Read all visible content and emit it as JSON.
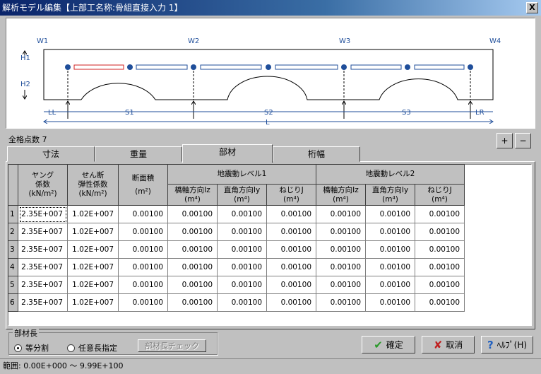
{
  "window": {
    "title": "解析モデル編集【上部工名称:骨組直接入力 1】",
    "close": "X"
  },
  "diagram": {
    "supports": [
      "W1",
      "W2",
      "W3",
      "W4"
    ],
    "heights": [
      "H1",
      "H2"
    ],
    "spans": [
      "LL",
      "S1",
      "S2",
      "S3",
      "LR"
    ],
    "total": "L",
    "selected_member": 1,
    "colors": {
      "node": "#1f4e9a",
      "member": "#1f4e9a",
      "selected": "#d02020"
    }
  },
  "summary": {
    "node_count_label": "全格点数 7"
  },
  "zoom": {
    "in": "+",
    "out": "−"
  },
  "tabs": [
    {
      "label": "寸法"
    },
    {
      "label": "重量"
    },
    {
      "label": "部材",
      "selected": true
    },
    {
      "label": "桁幅"
    }
  ],
  "table": {
    "headers": {
      "young": [
        "ヤング",
        "係数",
        "(kN/m²)"
      ],
      "shear": [
        "せん断",
        "弾性係数",
        "(kN/m²)"
      ],
      "area": [
        "断面積",
        "(m²)"
      ],
      "level1": "地震動レベル1",
      "level2": "地震動レベル2",
      "sub": [
        [
          "橋軸方向Iz",
          "(m⁴)"
        ],
        [
          "直角方向Iy",
          "(m⁴)"
        ],
        [
          "ねじりJ",
          "(m⁴)"
        ],
        [
          "橋軸方向Iz",
          "(m⁴)"
        ],
        [
          "直角方向Iy",
          "(m⁴)"
        ],
        [
          "ねじりJ",
          "(m⁴)"
        ]
      ]
    },
    "rows": [
      [
        "1",
        "2.35E+007",
        "1.02E+007",
        "0.00100",
        "0.00100",
        "0.00100",
        "0.00100",
        "0.00100",
        "0.00100",
        "0.00100"
      ],
      [
        "2",
        "2.35E+007",
        "1.02E+007",
        "0.00100",
        "0.00100",
        "0.00100",
        "0.00100",
        "0.00100",
        "0.00100",
        "0.00100"
      ],
      [
        "3",
        "2.35E+007",
        "1.02E+007",
        "0.00100",
        "0.00100",
        "0.00100",
        "0.00100",
        "0.00100",
        "0.00100",
        "0.00100"
      ],
      [
        "4",
        "2.35E+007",
        "1.02E+007",
        "0.00100",
        "0.00100",
        "0.00100",
        "0.00100",
        "0.00100",
        "0.00100",
        "0.00100"
      ],
      [
        "5",
        "2.35E+007",
        "1.02E+007",
        "0.00100",
        "0.00100",
        "0.00100",
        "0.00100",
        "0.00100",
        "0.00100",
        "0.00100"
      ],
      [
        "6",
        "2.35E+007",
        "1.02E+007",
        "0.00100",
        "0.00100",
        "0.00100",
        "0.00100",
        "0.00100",
        "0.00100",
        "0.00100"
      ]
    ]
  },
  "member_length": {
    "label": "部材長",
    "option_equal": "等分割",
    "option_custom": "任意長指定",
    "selected": "等分割",
    "check_button": "部材長チェック"
  },
  "buttons": {
    "ok": "確定",
    "cancel": "取消",
    "help": "ﾍﾙﾌﾟ(H)"
  },
  "status": {
    "range": "範囲: 0.00E+000 ～ 9.99E+100"
  }
}
